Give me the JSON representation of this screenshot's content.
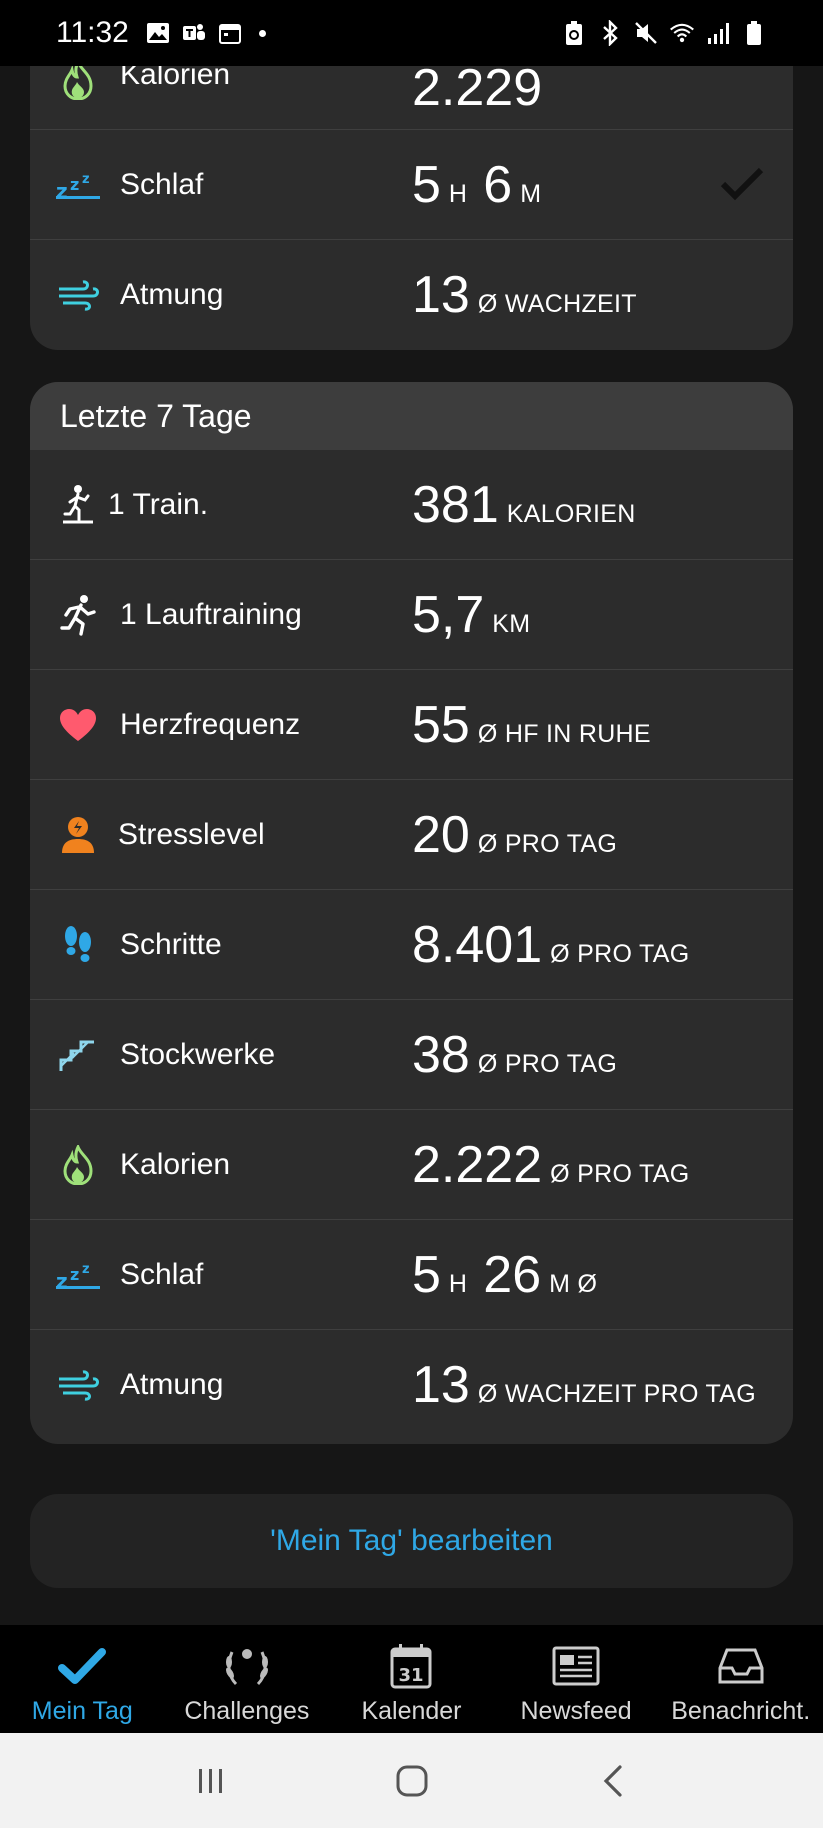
{
  "status_bar": {
    "time": "11:32"
  },
  "today": {
    "rows": [
      {
        "icon": "flame-icon",
        "label": "Kalorien",
        "value": "2.229",
        "unit": ""
      },
      {
        "icon": "sleep-icon",
        "label": "Schlaf",
        "value_h": "5",
        "unit_h": "H",
        "value_m": "6",
        "unit_m": "M",
        "checked": true
      },
      {
        "icon": "breathing-icon",
        "label": "Atmung",
        "value": "13",
        "unit": "Ø WACHZEIT"
      }
    ]
  },
  "last7": {
    "title": "Letzte 7 Tage",
    "rows": [
      {
        "icon": "strength-training-icon",
        "label": "1 Train.",
        "value": "381",
        "unit": "KALORIEN"
      },
      {
        "icon": "running-icon",
        "label": "1 Lauftraining",
        "value": "5,7",
        "unit": "KM"
      },
      {
        "icon": "heart-icon",
        "label": "Herzfrequenz",
        "value": "55",
        "unit": "Ø HF IN RUHE"
      },
      {
        "icon": "stress-icon",
        "label": "Stresslevel",
        "value": "20",
        "unit": "Ø PRO TAG"
      },
      {
        "icon": "footsteps-icon",
        "label": "Schritte",
        "value": "8.401",
        "unit": "Ø PRO TAG"
      },
      {
        "icon": "stairs-icon",
        "label": "Stockwerke",
        "value": "38",
        "unit": "Ø PRO TAG"
      },
      {
        "icon": "flame-icon",
        "label": "Kalorien",
        "value": "2.222",
        "unit": "Ø PRO TAG"
      },
      {
        "icon": "sleep-icon",
        "label": "Schlaf",
        "value_h": "5",
        "unit_h": "H",
        "value_m": "26",
        "unit_m": "M Ø"
      },
      {
        "icon": "breathing-icon",
        "label": "Atmung",
        "value": "13",
        "unit": "Ø WACHZEIT PRO TAG"
      }
    ]
  },
  "edit_button": "'Mein Tag' bearbeiten",
  "bottom_nav": [
    {
      "label": "Mein Tag",
      "icon": "checkmark-icon",
      "active": true
    },
    {
      "label": "Challenges",
      "icon": "laurel-icon",
      "active": false
    },
    {
      "label": "Kalender",
      "icon": "calendar-icon",
      "calendar_day": "31",
      "active": false
    },
    {
      "label": "Newsfeed",
      "icon": "newspaper-icon",
      "active": false
    },
    {
      "label": "Benachricht.",
      "icon": "inbox-icon",
      "active": false
    }
  ],
  "colors": {
    "accent": "#2fa8e6",
    "card": "#2c2c2c",
    "header": "#3d3d3d",
    "flame": "#9fe07a",
    "sleep": "#2fa8e6",
    "breath": "#3fd0e0",
    "heart": "#ff5a6e",
    "stress": "#f0821e",
    "steps": "#2fa8e6"
  }
}
